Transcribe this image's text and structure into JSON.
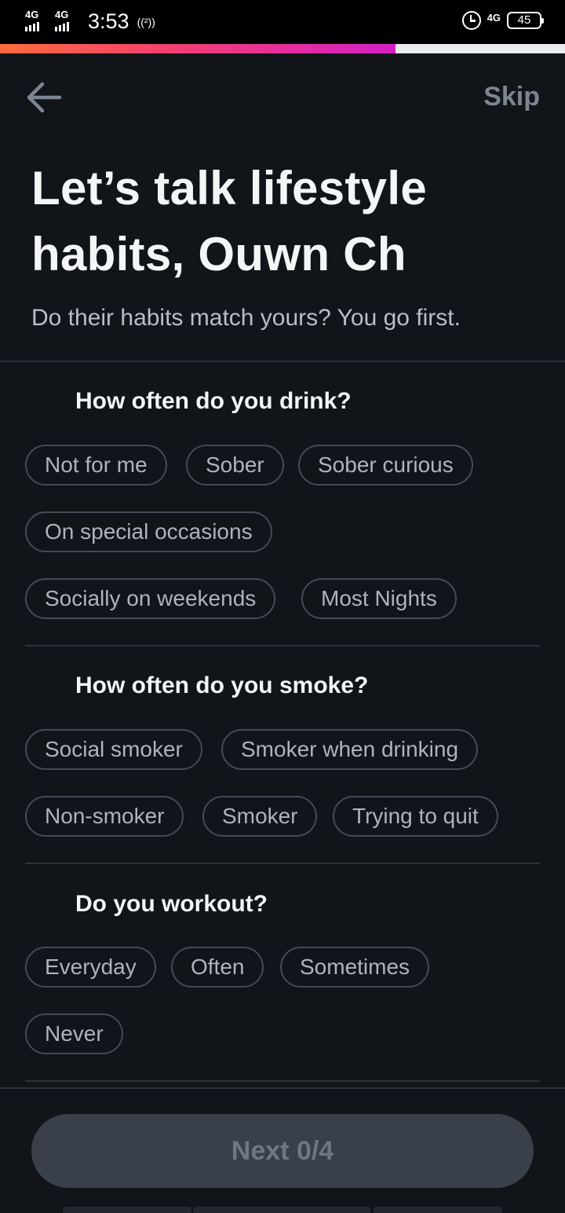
{
  "status_bar": {
    "net1": "4G",
    "net2": "4G",
    "time": "3:53",
    "hotspot": "((²))",
    "net3": "4G",
    "battery": "45"
  },
  "progress": {
    "fraction": 0.7
  },
  "header": {
    "skip_label": "Skip"
  },
  "title": "Let’s talk lifestyle habits, Ouwn Ch",
  "subtitle": "Do their habits match yours? You go first.",
  "sections": [
    {
      "title": "How often do you drink?",
      "options": [
        "Not for me",
        "Sober",
        "Sober curious",
        "On special occasions",
        "Socially on weekends",
        "Most Nights"
      ]
    },
    {
      "title": "How often do you smoke?",
      "options": [
        "Social smoker",
        "Smoker when drinking",
        "Non-smoker",
        "Smoker",
        "Trying to quit"
      ]
    },
    {
      "title": "Do you workout?",
      "options": [
        "Everyday",
        "Often",
        "Sometimes",
        "Never"
      ]
    }
  ],
  "next_button": "Next 0/4",
  "colors": {
    "accent_start": "#ff6b3d",
    "accent_end": "#d61ec7",
    "background": "#111418"
  }
}
